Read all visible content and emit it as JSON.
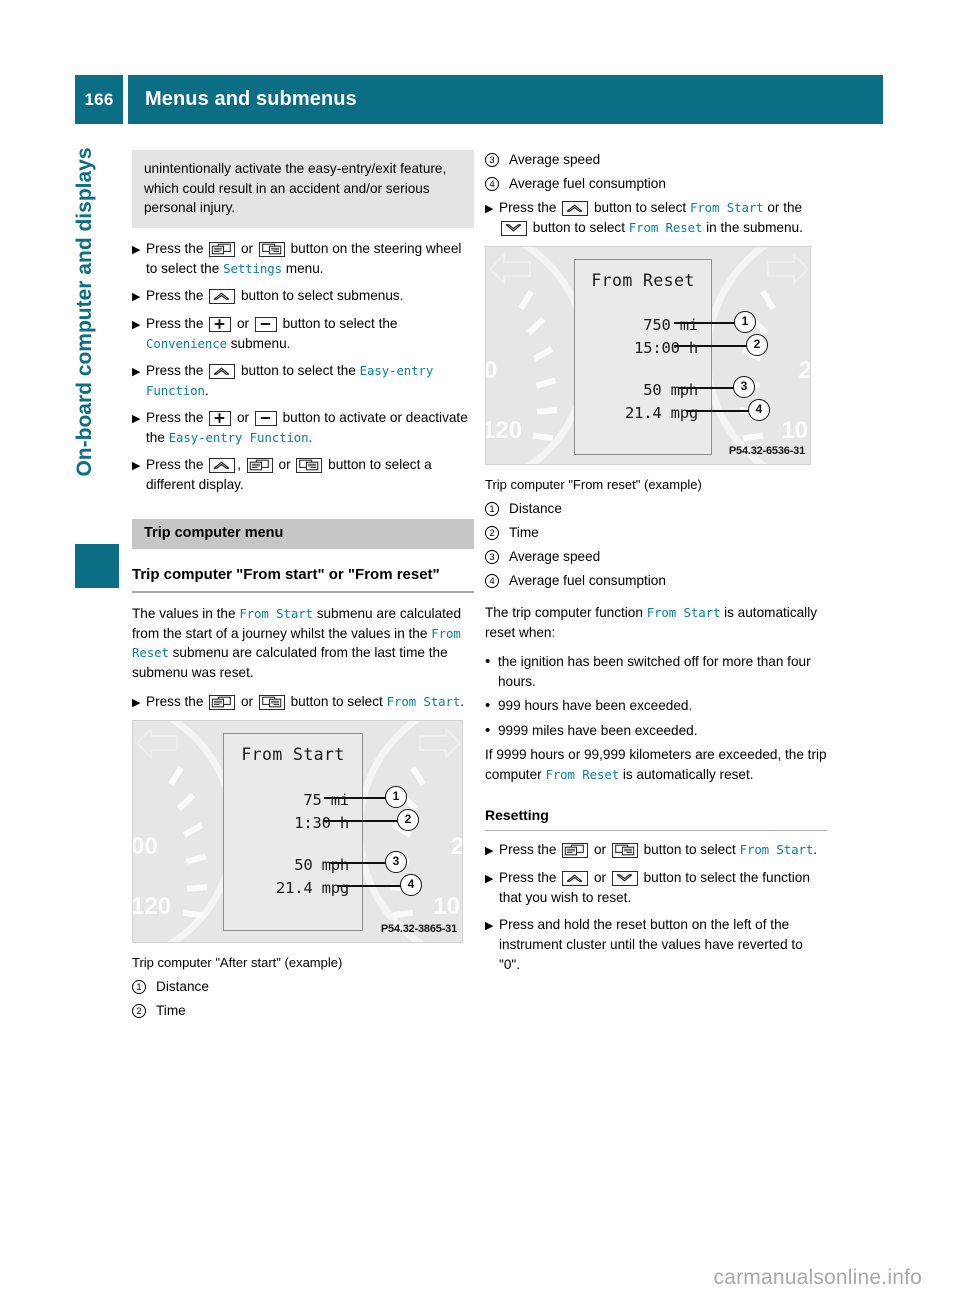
{
  "header": {
    "page_number": "166",
    "title": "Menus and submenus"
  },
  "side_tab": {
    "label": "On-board computer and displays"
  },
  "footer": {
    "watermark": "carmanualsonline.info"
  },
  "left_column": {
    "warning_text": "unintentionally activate the easy-entry/exit feature, which could result in an accident and/or serious personal injury.",
    "steps": [
      {
        "marker": "▶",
        "parts": [
          {
            "t": "text",
            "v": "Press the "
          },
          {
            "t": "icon",
            "v": "page-left-button-icon"
          },
          {
            "t": "text",
            "v": " or "
          },
          {
            "t": "icon",
            "v": "page-right-button-icon"
          },
          {
            "t": "text",
            "v": " button on the steering wheel to select the "
          },
          {
            "t": "ui",
            "v": "Settings"
          },
          {
            "t": "text",
            "v": " menu."
          }
        ]
      },
      {
        "marker": "▶",
        "parts": [
          {
            "t": "text",
            "v": "Press the "
          },
          {
            "t": "icon",
            "v": "up-arrow-button-icon"
          },
          {
            "t": "text",
            "v": " button to select submenus."
          }
        ]
      },
      {
        "marker": "▶",
        "parts": [
          {
            "t": "text",
            "v": "Press the "
          },
          {
            "t": "icon",
            "v": "plus-button-icon"
          },
          {
            "t": "text",
            "v": " or "
          },
          {
            "t": "icon",
            "v": "minus-button-icon"
          },
          {
            "t": "text",
            "v": " button to select the "
          },
          {
            "t": "ui",
            "v": "Convenience"
          },
          {
            "t": "text",
            "v": " submenu."
          }
        ]
      },
      {
        "marker": "▶",
        "parts": [
          {
            "t": "text",
            "v": "Press the "
          },
          {
            "t": "icon",
            "v": "up-arrow-button-icon"
          },
          {
            "t": "text",
            "v": " button to select the "
          },
          {
            "t": "ui",
            "v": "Easy-entry Function"
          },
          {
            "t": "text",
            "v": "."
          }
        ]
      },
      {
        "marker": "▶",
        "parts": [
          {
            "t": "text",
            "v": "Press the "
          },
          {
            "t": "icon",
            "v": "plus-button-icon"
          },
          {
            "t": "text",
            "v": " or "
          },
          {
            "t": "icon",
            "v": "minus-button-icon"
          },
          {
            "t": "text",
            "v": " button to activate or deactivate the "
          },
          {
            "t": "ui",
            "v": "Easy-entry Function"
          },
          {
            "t": "text",
            "v": "."
          }
        ]
      },
      {
        "marker": "▶",
        "parts": [
          {
            "t": "text",
            "v": "Press the "
          },
          {
            "t": "icon",
            "v": "up-arrow-button-icon"
          },
          {
            "t": "text",
            "v": ", "
          },
          {
            "t": "icon",
            "v": "page-left-button-icon"
          },
          {
            "t": "text",
            "v": " or "
          },
          {
            "t": "icon",
            "v": "page-right-button-icon"
          },
          {
            "t": "text",
            "v": " button to select a different display."
          }
        ]
      }
    ],
    "section_bar": "Trip computer menu",
    "subheading": "Trip computer \"From start\" or \"From reset\"",
    "body_paragraph": [
      {
        "t": "text",
        "v": "The values in the "
      },
      {
        "t": "ui",
        "v": "From Start"
      },
      {
        "t": "text",
        "v": " submenu are calculated from the start of a journey whilst the values in the "
      },
      {
        "t": "ui",
        "v": "From Reset"
      },
      {
        "t": "text",
        "v": " submenu are calculated from the last time the submenu was reset."
      }
    ],
    "step_from_start": {
      "marker": "▶",
      "parts": [
        {
          "t": "text",
          "v": "Press the "
        },
        {
          "t": "icon",
          "v": "page-left-button-icon"
        },
        {
          "t": "text",
          "v": " or "
        },
        {
          "t": "icon",
          "v": "page-right-button-icon"
        },
        {
          "t": "text",
          "v": " button to select "
        },
        {
          "t": "ui",
          "v": "From Start"
        },
        {
          "t": "text",
          "v": "."
        }
      ]
    },
    "figure": {
      "lcd_title": "From Start",
      "values": [
        "75 mi",
        "1:30 h",
        "50 mph",
        "21.4 mpg"
      ],
      "callouts": [
        "1",
        "2",
        "3",
        "4"
      ],
      "dial_numbers": [
        "00",
        "120",
        "2",
        "10"
      ],
      "code": "P54.32-3865-31"
    },
    "caption": "Trip computer \"After start\" (example)",
    "legend": [
      {
        "num": "1",
        "label": "Distance"
      },
      {
        "num": "2",
        "label": "Time"
      }
    ]
  },
  "right_column": {
    "legend_top": [
      {
        "num": "3",
        "label": "Average speed"
      },
      {
        "num": "4",
        "label": "Average fuel consumption"
      }
    ],
    "step_select": {
      "marker": "▶",
      "parts": [
        {
          "t": "text",
          "v": "Press the "
        },
        {
          "t": "icon",
          "v": "up-arrow-button-icon"
        },
        {
          "t": "text",
          "v": " button to select "
        },
        {
          "t": "ui",
          "v": "From Start"
        },
        {
          "t": "text",
          "v": " or the "
        },
        {
          "t": "icon",
          "v": "down-arrow-button-icon"
        },
        {
          "t": "text",
          "v": " button to select "
        },
        {
          "t": "ui",
          "v": "From Reset"
        },
        {
          "t": "text",
          "v": " in the submenu."
        }
      ]
    },
    "figure": {
      "lcd_title": "From Reset",
      "values": [
        "750 mi",
        "15:00 h",
        "50 mph",
        "21.4 mpg"
      ],
      "callouts": [
        "1",
        "2",
        "3",
        "4"
      ],
      "dial_numbers": [
        "0",
        "120",
        "2",
        "10"
      ],
      "code": "P54.32-6536-31"
    },
    "caption": "Trip computer \"From reset\" (example)",
    "legend": [
      {
        "num": "1",
        "label": "Distance"
      },
      {
        "num": "2",
        "label": "Time"
      },
      {
        "num": "3",
        "label": "Average speed"
      },
      {
        "num": "4",
        "label": "Average fuel consumption"
      }
    ],
    "auto_reset_intro": [
      {
        "t": "text",
        "v": "The trip computer function "
      },
      {
        "t": "ui",
        "v": "From Start"
      },
      {
        "t": "text",
        "v": " is automatically reset when:"
      }
    ],
    "auto_reset_bullets": [
      "the ignition has been switched off for more than four hours.",
      "999 hours have been exceeded.",
      "9999 miles have been exceeded."
    ],
    "exceed_paragraph": [
      {
        "t": "text",
        "v": "If 9999 hours or 99,999 kilometers are exceeded, the trip computer "
      },
      {
        "t": "ui",
        "v": "From Reset"
      },
      {
        "t": "text",
        "v": " is automatically reset."
      }
    ],
    "resetting_heading": "Resetting",
    "resetting_steps": [
      {
        "marker": "▶",
        "parts": [
          {
            "t": "text",
            "v": "Press the "
          },
          {
            "t": "icon",
            "v": "page-left-button-icon"
          },
          {
            "t": "text",
            "v": " or "
          },
          {
            "t": "icon",
            "v": "page-right-button-icon"
          },
          {
            "t": "text",
            "v": " button to select "
          },
          {
            "t": "ui",
            "v": "From Start"
          },
          {
            "t": "text",
            "v": "."
          }
        ]
      },
      {
        "marker": "▶",
        "parts": [
          {
            "t": "text",
            "v": "Press the "
          },
          {
            "t": "icon",
            "v": "up-arrow-button-icon"
          },
          {
            "t": "text",
            "v": " or "
          },
          {
            "t": "icon",
            "v": "down-arrow-button-icon"
          },
          {
            "t": "text",
            "v": " button to select the function that you wish to reset."
          }
        ]
      },
      {
        "marker": "▶",
        "parts": [
          {
            "t": "text",
            "v": "Press and hold the reset button on the left of the instrument cluster until the values have reverted to \"0\"."
          }
        ]
      }
    ]
  },
  "colors": {
    "teal": "#0c6e85",
    "ui_teal": "#0c7f96",
    "warn_gray": "#e3e3e3",
    "bar_gray": "#c6c6c6"
  }
}
